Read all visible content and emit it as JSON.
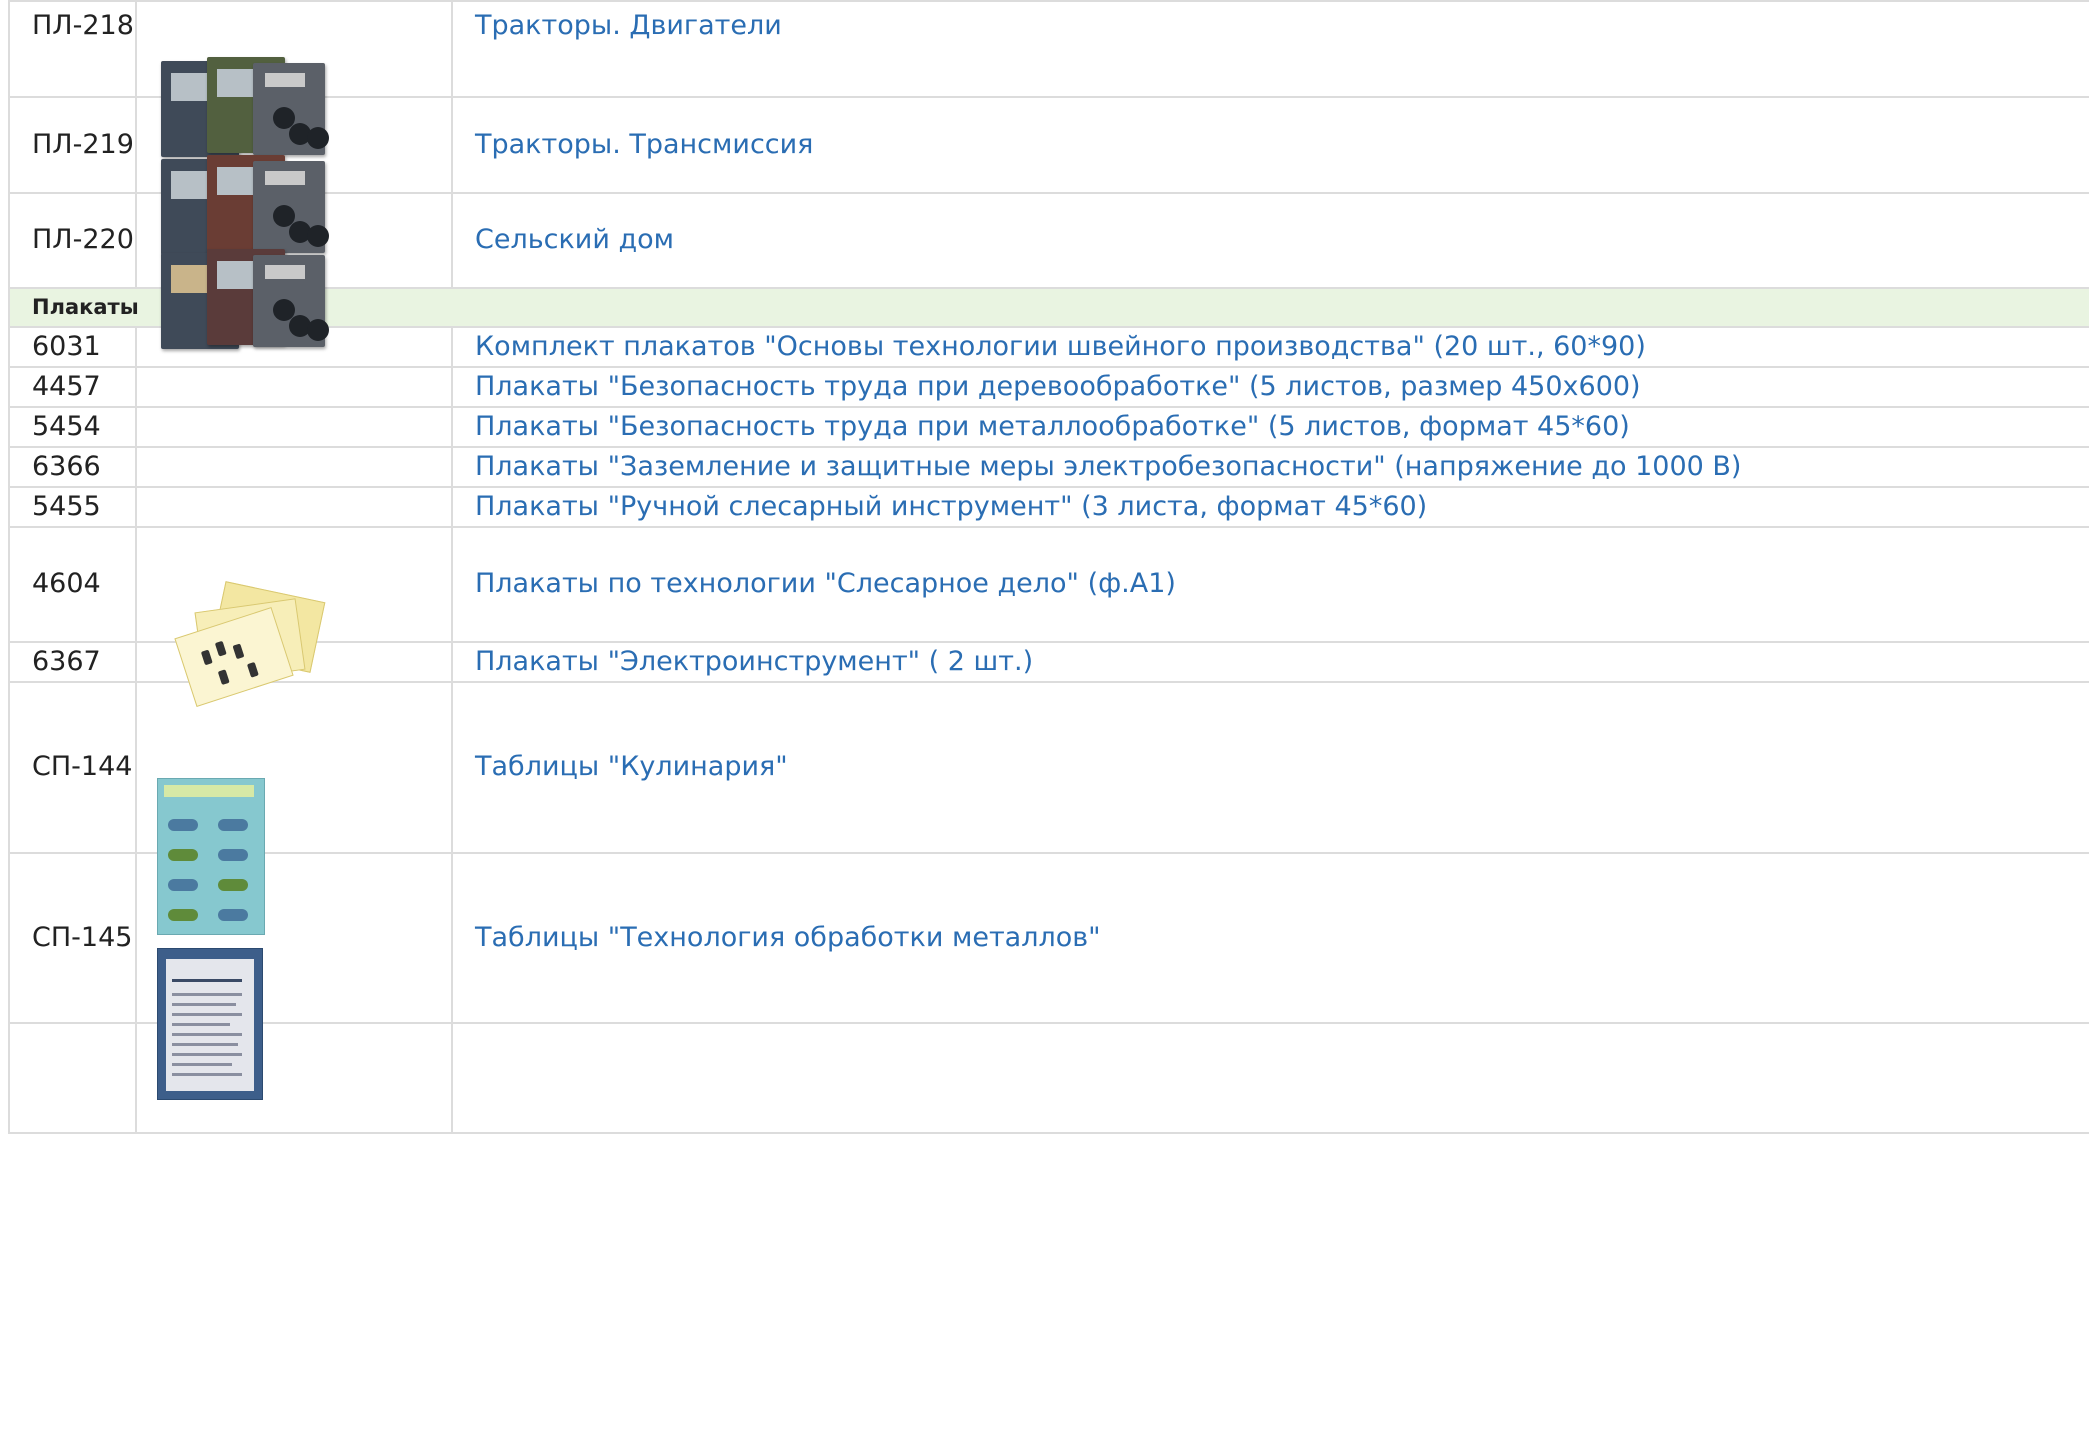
{
  "colors": {
    "link": "#2a6db3",
    "section_bg": "#e9f4e1",
    "border": "#dcdcdc"
  },
  "rows": {
    "r1": {
      "code": "ПЛ-218",
      "name": "Тракторы. Двигатели"
    },
    "r2": {
      "code": "ПЛ-219",
      "name": "Тракторы. Трансмиссия"
    },
    "r3": {
      "code": "ПЛ-220",
      "name": "Сельский дом"
    },
    "section": {
      "title": "Плакаты"
    },
    "r4": {
      "code": "6031",
      "name": "Комплект плакатов \"Основы технологии швейного производства\" (20 шт., 60*90)"
    },
    "r5": {
      "code": "4457",
      "name": "Плакаты \"Безопасность труда при деревообработке\" (5 листов, размер 450х600)"
    },
    "r6": {
      "code": "5454",
      "name": "Плакаты \"Безопасность труда при металлообработке\" (5 листов, формат 45*60)"
    },
    "r7": {
      "code": "6366",
      "name": "Плакаты \"Заземление и защитные меры электробезопасности\" (напряжение до 1000 В)"
    },
    "r8": {
      "code": "5455",
      "name": "Плакаты \"Ручной слесарный инструмент\" (3 листа, формат 45*60)"
    },
    "r9": {
      "code": "4604",
      "name": "Плакаты по технологии \"Слесарное дело\" (ф.А1)"
    },
    "r10": {
      "code": "6367",
      "name": "Плакаты \"Электроинструмент\" ( 2 шт.)"
    },
    "r11": {
      "code": "СП-144",
      "name": "Таблицы \"Кулинария\""
    },
    "r12": {
      "code": "СП-145",
      "name": "Таблицы \"Технология обработки металлов\""
    }
  }
}
